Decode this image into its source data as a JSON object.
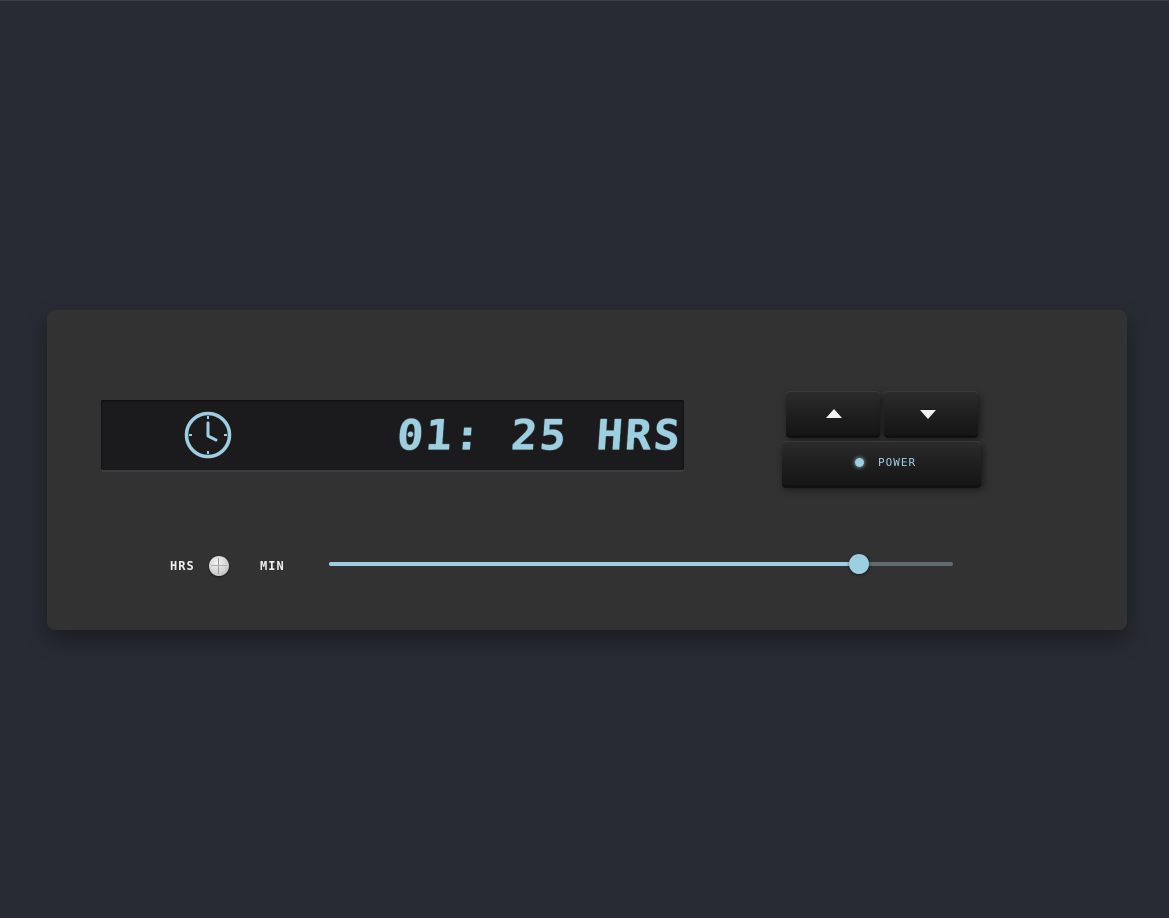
{
  "timer": {
    "time_display": "01: 25 HRS"
  },
  "controls": {
    "up_icon": "triangle-up-icon",
    "down_icon": "triangle-down-icon",
    "power_label": "POWER",
    "power_indicator_on": true
  },
  "unit_toggle": {
    "left_label": "HRS",
    "right_label": "MIN",
    "selected": "HRS"
  },
  "slider": {
    "value_fraction": 0.85
  },
  "colors": {
    "page_background": "#282b33",
    "panel_background": "#323232",
    "display_background": "#1b1b1d",
    "accent": "#9ccfe0",
    "track": "#5e6a6f"
  }
}
